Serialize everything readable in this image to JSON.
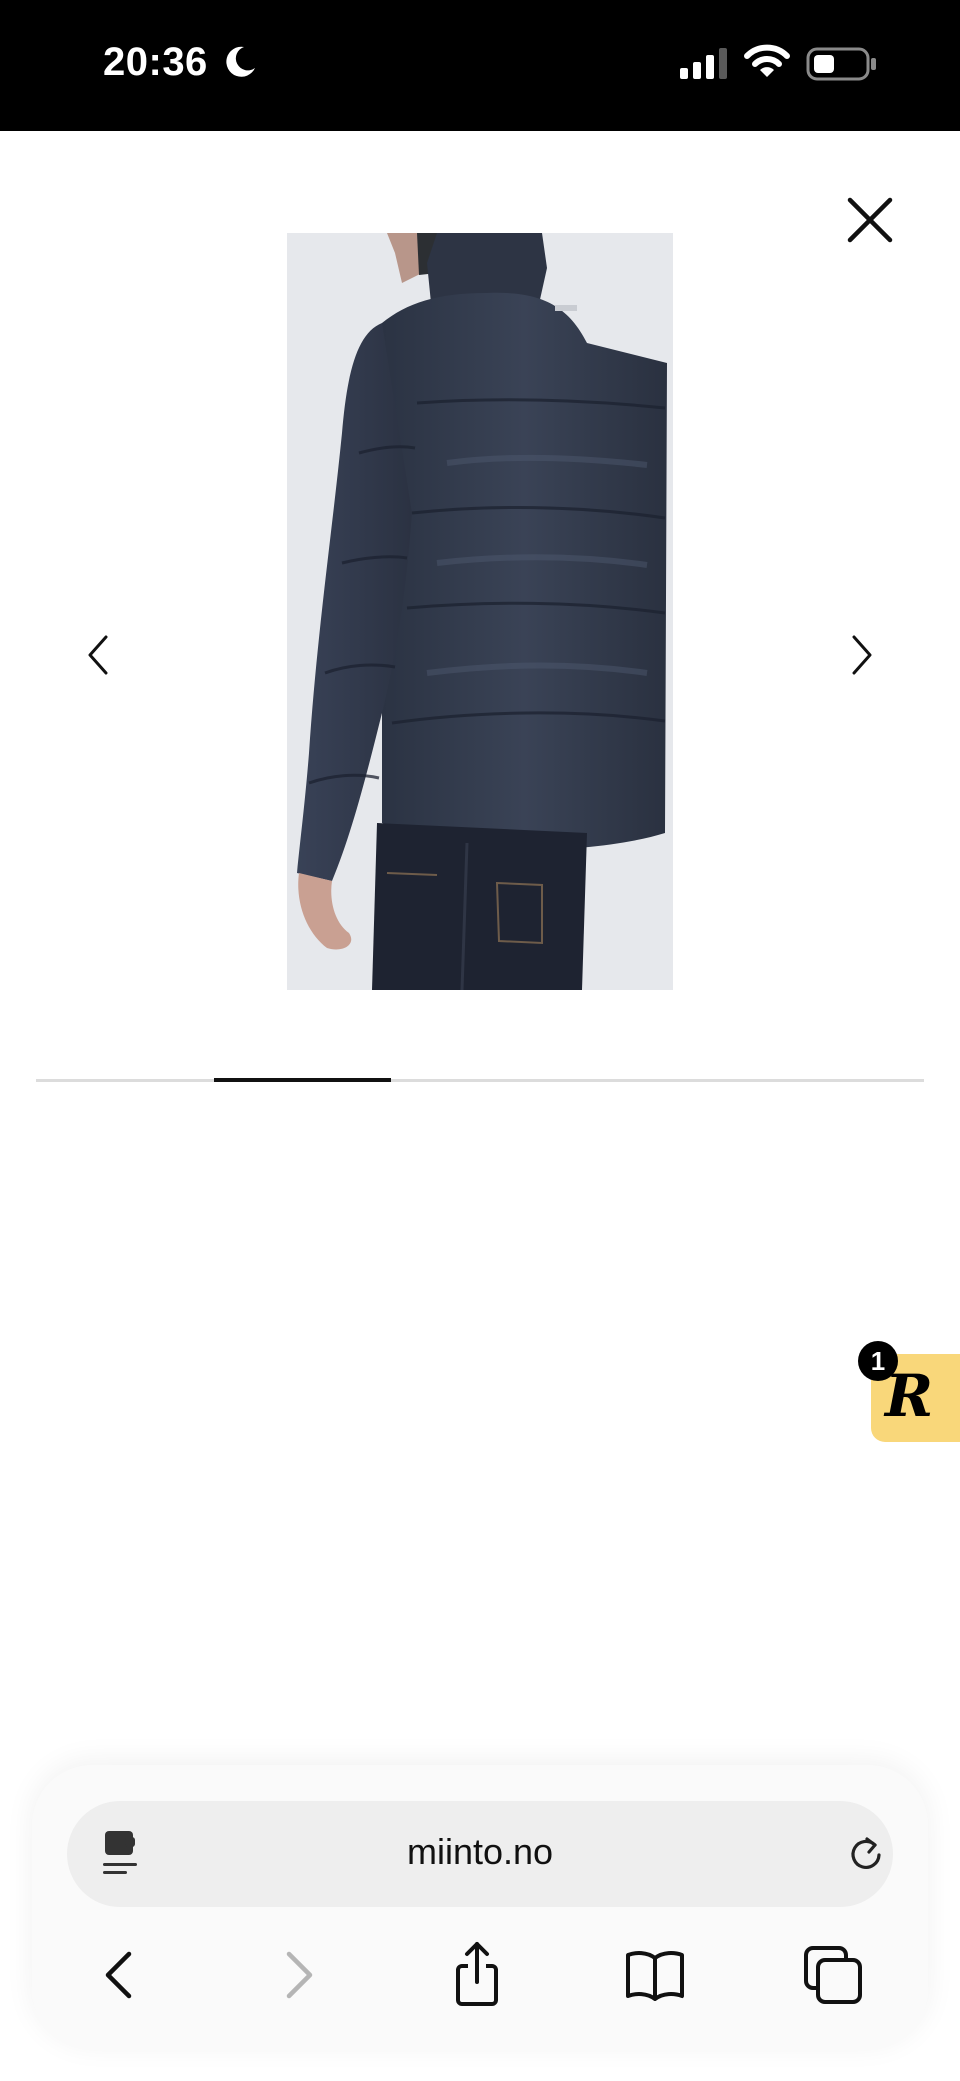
{
  "status_bar": {
    "time": "20:36",
    "icons": [
      "moon-icon",
      "cellular-signal-icon",
      "wifi-icon",
      "battery-icon"
    ]
  },
  "viewer": {
    "close_icon": "close-icon",
    "prev_icon": "chevron-left-icon",
    "next_icon": "chevron-right-icon",
    "product_image": "navy puffer jacket back view",
    "progress": {
      "total_images": 5,
      "current_index": 2
    }
  },
  "rewards": {
    "letter": "R",
    "badge_count": "1",
    "color": "#f9d77a"
  },
  "browser": {
    "url": "miinto.no",
    "toolbar": [
      "back-icon",
      "forward-icon",
      "share-icon",
      "bookmarks-icon",
      "tabs-icon"
    ]
  }
}
